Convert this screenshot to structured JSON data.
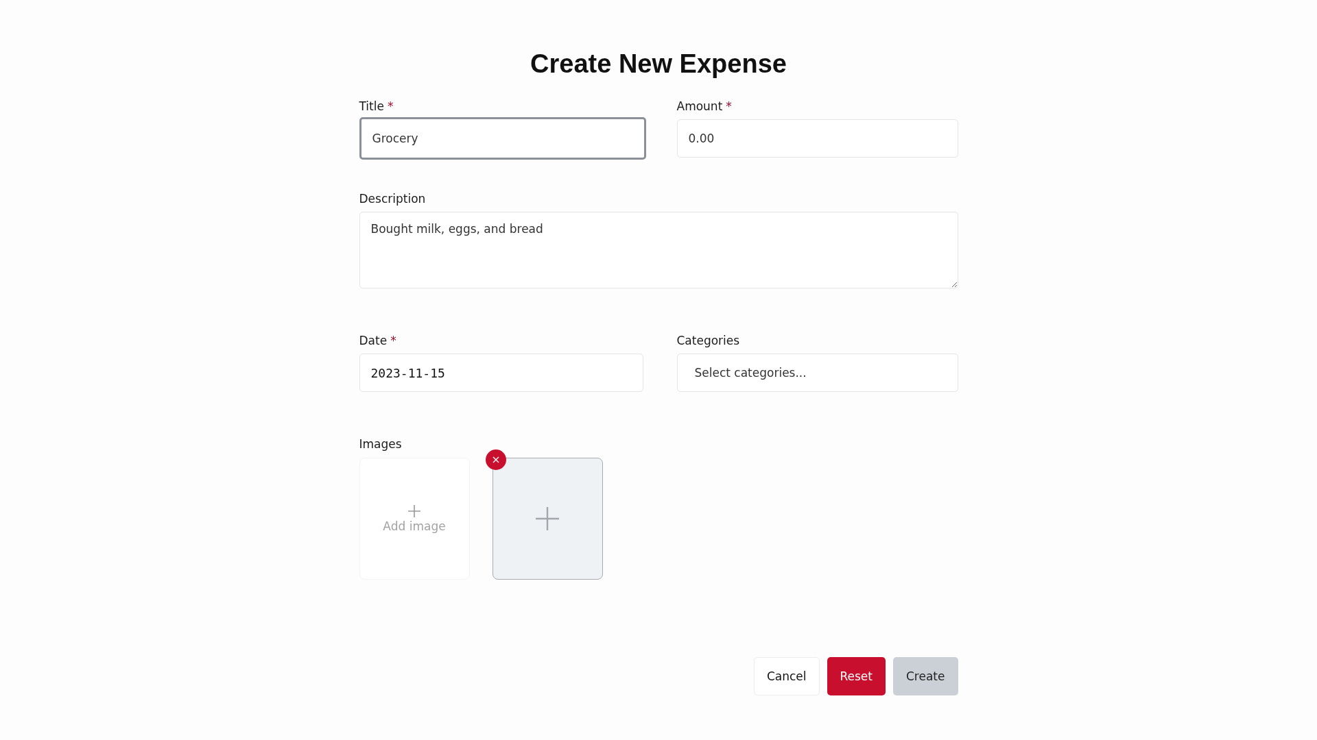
{
  "heading": "Create New Expense",
  "fields": [
    {
      "kind": "text",
      "label": "Title",
      "required_mark": "*",
      "value": "Grocery",
      "focused": true
    },
    {
      "kind": "text",
      "label": "Amount",
      "required_mark": "*",
      "value": "0.00",
      "focused": false
    },
    {
      "kind": "textarea",
      "label": "Description",
      "value": "Bought milk, eggs, and bread",
      "focused": false
    },
    {
      "kind": "date",
      "label": "Date",
      "required_mark": "*",
      "value": "2023-11-15",
      "focused": false
    },
    {
      "kind": "select",
      "label": "Categories",
      "placeholder": "Select categories...",
      "focused": false
    }
  ],
  "images": {
    "label": "Images",
    "tiles": [
      {
        "kind": "add",
        "label": "Add image"
      },
      {
        "kind": "preview"
      }
    ]
  },
  "buttons": [
    {
      "kind": "secondary",
      "label": "Cancel"
    },
    {
      "kind": "danger",
      "label": "Reset"
    },
    {
      "kind": "muted",
      "label": "Create"
    }
  ]
}
